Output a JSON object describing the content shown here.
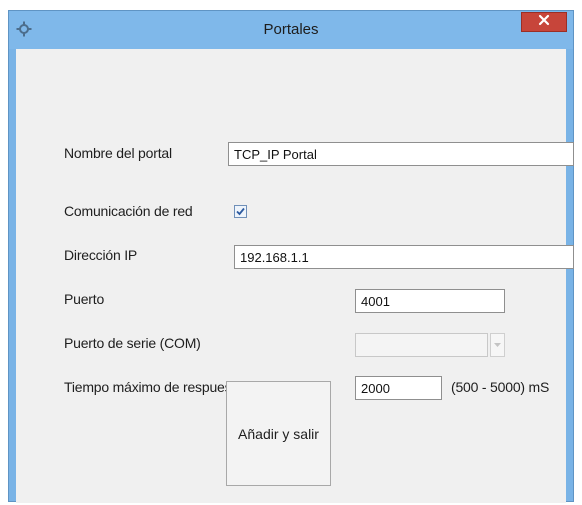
{
  "window": {
    "title": "Portales",
    "app_icon": "gear-icon",
    "close_icon": "close-icon"
  },
  "form": {
    "portal_name": {
      "label": "Nombre del portal",
      "value": "TCP_IP Portal"
    },
    "network_comm": {
      "label": "Comunicación de red",
      "checked": true
    },
    "ip_address": {
      "label": "Dirección IP",
      "value": "192.168.1.1"
    },
    "port": {
      "label": "Puerto",
      "value": "4001"
    },
    "serial_port": {
      "label": "Puerto de serie (COM)",
      "value": ""
    },
    "max_response": {
      "label": "Tiempo máximo de respuesta",
      "value": "2000",
      "range_text": "(500 - 5000) mS"
    }
  },
  "actions": {
    "add_exit_label": "Añadir y salir"
  },
  "colors": {
    "titlebar": "#7fb8ea",
    "close_button": "#c7453a",
    "client_background": "#f0f0f0"
  }
}
